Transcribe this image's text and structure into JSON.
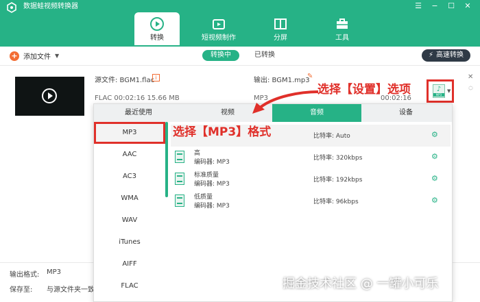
{
  "app": {
    "title": "数据蛙视频转换器",
    "win_controls": [
      "☰",
      "−",
      "☐",
      "✕"
    ]
  },
  "tabs": [
    {
      "label": "转换",
      "active": true
    },
    {
      "label": "短视频制作",
      "active": false
    },
    {
      "label": "分屏",
      "active": false
    },
    {
      "label": "工具",
      "active": false
    }
  ],
  "toolbar": {
    "add_file": "添加文件",
    "status_converting": "转换中",
    "status_converted": "已转换",
    "fast_convert": "高速转换"
  },
  "file": {
    "source": "源文件:  BGM1.flac",
    "source_info": "FLAC    00:02:16    15.66 MB",
    "output": "输出:  BGM1.mp3",
    "output_format": "MP3",
    "output_duration": "00:02:16"
  },
  "annotations": {
    "settings": "选择【设置】选项",
    "mp3": "选择【MP3】格式"
  },
  "panel": {
    "tabs": [
      {
        "label": "最近使用",
        "active": false
      },
      {
        "label": "视频",
        "active": false
      },
      {
        "label": "音频",
        "active": true
      },
      {
        "label": "设备",
        "active": false
      }
    ],
    "formats": [
      "MP3",
      "AAC",
      "AC3",
      "WMA",
      "WAV",
      "iTunes",
      "AIFF",
      "FLAC"
    ],
    "selected_format": "MP3",
    "qualities": [
      {
        "title": "",
        "encoder": "",
        "bitrate": "比特率:    Auto"
      },
      {
        "title": "高",
        "encoder": "编码器:    MP3",
        "bitrate": "比特率:    320kbps"
      },
      {
        "title": "标准质量",
        "encoder": "编码器:    MP3",
        "bitrate": "比特率:    192kbps"
      },
      {
        "title": "低质量",
        "encoder": "编码器:    MP3",
        "bitrate": "比特率:    96kbps"
      }
    ]
  },
  "bottom": {
    "output_format_label": "输出格式:",
    "output_format_value": "MP3",
    "save_to_label": "保存至:",
    "save_to_value": "与源文件夹一致"
  },
  "watermark": "掘金技术社区 @ 一罐小可乐",
  "colors": {
    "brand": "#26b286",
    "accent": "#f36d33",
    "highlight": "#e0302a"
  }
}
